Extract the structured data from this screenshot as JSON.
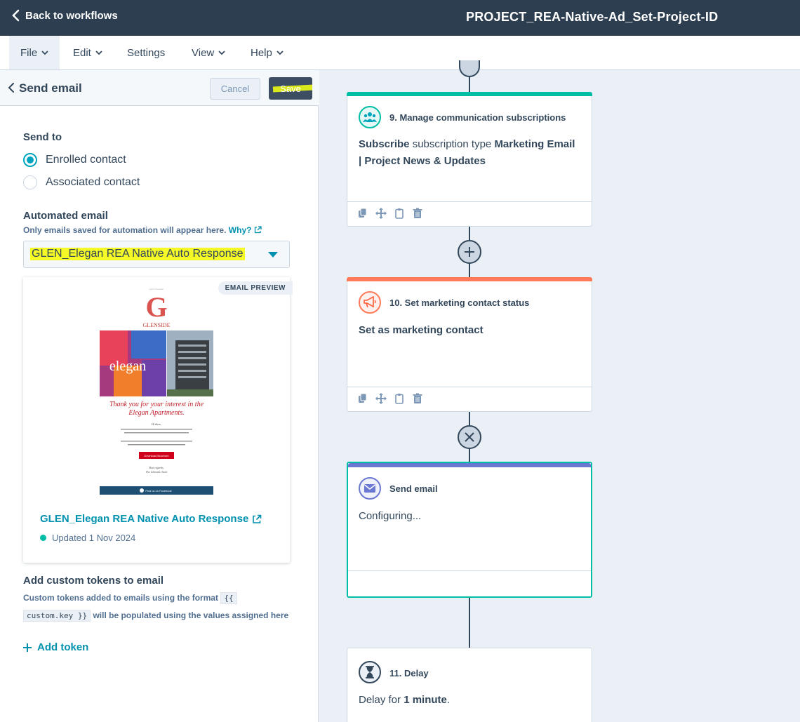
{
  "topbar": {
    "back_label": "Back to workflows",
    "workflow_title": "PROJECT_REA-Native-Ad_Set-Project-ID"
  },
  "menu": {
    "file": "File",
    "edit": "Edit",
    "settings": "Settings",
    "view": "View",
    "help": "Help"
  },
  "panel": {
    "title": "Send email",
    "cancel_label": "Cancel",
    "save_label": "Save",
    "send_to_label": "Send to",
    "options": [
      "Enrolled contact",
      "Associated contact"
    ],
    "selected_option": "Enrolled contact",
    "automated_email_label": "Automated email",
    "automated_hint": "Only emails saved for automation will appear here.",
    "why_link": "Why?",
    "selected_email": "GLEN_Elegan REA Native Auto Response",
    "preview_badge": "EMAIL PREVIEW",
    "preview": {
      "brand": "GLENSIDE",
      "hero_word": "elegan",
      "headline": "Thank you for your interest in the Elegan Apartments.",
      "greeting": "Hi there,",
      "cta": "Download Brochure",
      "signoff": "Best regards,",
      "team": "The Glenside Team",
      "footer": "Find us on Facebook"
    },
    "email_link": "GLEN_Elegan REA Native Auto Response",
    "email_updated": "Updated 1 Nov 2024",
    "tokens_label": "Add custom tokens to email",
    "tokens_desc_1": "Custom tokens added to emails using the format",
    "tokens_code_1": "{{",
    "tokens_code_2": "custom.key }}",
    "tokens_desc_2": "will be populated using the values assigned here",
    "add_token_label": "Add token"
  },
  "canvas": {
    "node9": {
      "title": "9. Manage communication subscriptions",
      "b1": "Subscribe",
      "b2": " subscription type ",
      "b3": "Marketing Email | Project News & Updates",
      "accent": "#00bda5"
    },
    "node10": {
      "title": "10. Set marketing contact status",
      "body": "Set as marketing contact",
      "accent": "#ff7a59"
    },
    "node_send": {
      "title": "Send email",
      "body": "Configuring...",
      "accent": "#6a78d1"
    },
    "node11": {
      "title": "11. Delay",
      "body_pre": "Delay for ",
      "body_bold": "1 minute",
      "body_post": "."
    }
  }
}
